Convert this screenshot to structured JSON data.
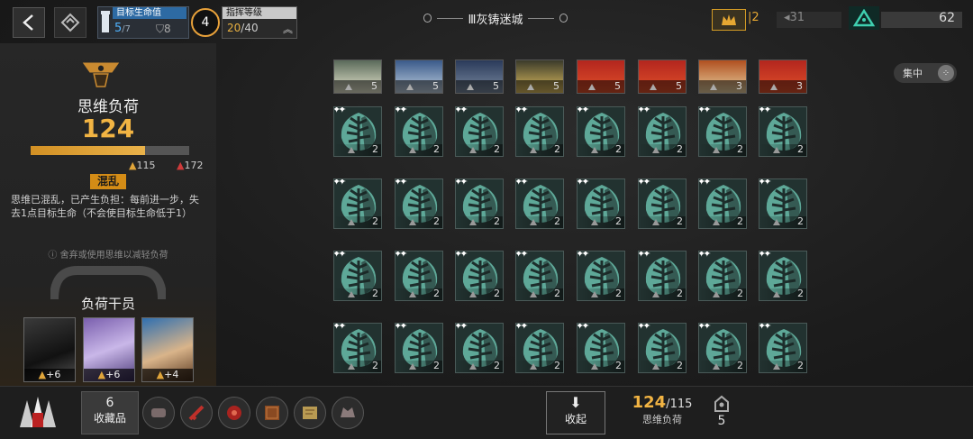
{
  "header": {
    "hp_label": "目标生命值",
    "hp_current": "5",
    "hp_max": "/7",
    "shield": "8",
    "level": "4",
    "command_label": "指挥等级",
    "command_current": "20",
    "command_max": "/40",
    "stage_title": "Ⅲ灰铸迷城",
    "gold_count": "2",
    "gold_limit": "31",
    "candle_count": "62"
  },
  "focus": {
    "label": "集中",
    "icon": "grid-dots-icon"
  },
  "left_panel": {
    "load_title": "思维负荷",
    "load_value": "124",
    "load_fill": 0.72,
    "threshold_a": "115",
    "threshold_b": "172",
    "status_tag": "混乱",
    "status_desc": "思维已混乱，已产生负担：每前进一步，失去1点目标生命（不会使目标生命低于1）",
    "hint": "ⓘ 舍弃或使用思维以减轻负荷",
    "ops_title": "负荷干员",
    "operators": [
      {
        "bonus": "+6"
      },
      {
        "bonus": "+6"
      },
      {
        "bonus": "+4"
      }
    ]
  },
  "top_row_cards": [
    {
      "count": "5"
    },
    {
      "count": "5"
    },
    {
      "count": "5"
    },
    {
      "count": "5"
    },
    {
      "count": "5"
    },
    {
      "count": "5"
    },
    {
      "count": "3"
    },
    {
      "count": "3"
    }
  ],
  "grid_cards": {
    "count": "2",
    "icon": "tree-leaf-icon"
  },
  "bottom": {
    "collection_count": "6",
    "collection_label": "收藏品",
    "collapse_label": "收起",
    "load_current": "124",
    "load_limit": "/115",
    "load_label": "思维负荷",
    "key_count": "5"
  },
  "colors": {
    "accent": "#f2b443",
    "teal": "#223230",
    "hp_blue": "#2d6aa3"
  }
}
